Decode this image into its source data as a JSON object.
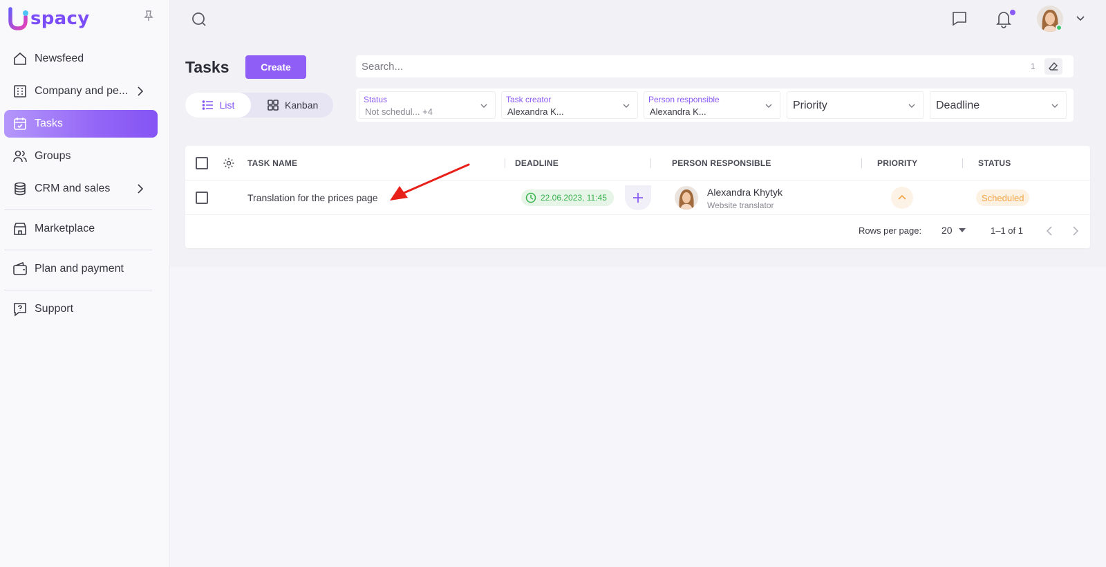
{
  "app": {
    "logo_text": "spacy",
    "brand_color": "#8e5ef6"
  },
  "sidebar": {
    "items": [
      {
        "label": "Newsfeed",
        "icon": "home-icon"
      },
      {
        "label": "Company and pe...",
        "icon": "building-icon",
        "has_submenu": true
      },
      {
        "label": "Tasks",
        "icon": "calendar-check-icon",
        "active": true
      },
      {
        "label": "Groups",
        "icon": "users-icon"
      },
      {
        "label": "CRM and sales",
        "icon": "coins-stack-icon",
        "has_submenu": true
      },
      {
        "label": "Marketplace",
        "icon": "store-icon"
      },
      {
        "label": "Plan and payment",
        "icon": "wallet-icon"
      },
      {
        "label": "Support",
        "icon": "help-chat-icon"
      }
    ]
  },
  "header": {
    "title": "Tasks",
    "create_label": "Create",
    "views": {
      "list": "List",
      "kanban": "Kanban",
      "selected": "list"
    },
    "search": {
      "placeholder": "Search...",
      "count": "1"
    },
    "filters": [
      {
        "label": "Status",
        "value": "Not schedul...",
        "extra": "+4"
      },
      {
        "label": "Task creator",
        "value": "Alexandra K..."
      },
      {
        "label": "Person responsible",
        "value": "Alexandra K..."
      },
      {
        "placeholder": "Priority"
      },
      {
        "placeholder": "Deadline"
      }
    ]
  },
  "table": {
    "columns": [
      "TASK NAME",
      "DEADLINE",
      "PERSON RESPONSIBLE",
      "PRIORITY",
      "STATUS"
    ],
    "rows": [
      {
        "task_name": "Translation for the prices page",
        "deadline": "22.06.2023, 11:45",
        "person_name": "Alexandra Khytyk",
        "person_role": "Website translator",
        "priority_icon": "chevron-up-icon",
        "status": "Scheduled"
      }
    ],
    "footer": {
      "rows_per_page_label": "Rows per page:",
      "rows_per_page": "20",
      "range": "1–1 of 1"
    }
  },
  "colors": {
    "accent": "#8e5ef6",
    "deadline_green": "#37b24d",
    "status_orange": "#f2a445",
    "annotation_red": "#e8201a"
  }
}
